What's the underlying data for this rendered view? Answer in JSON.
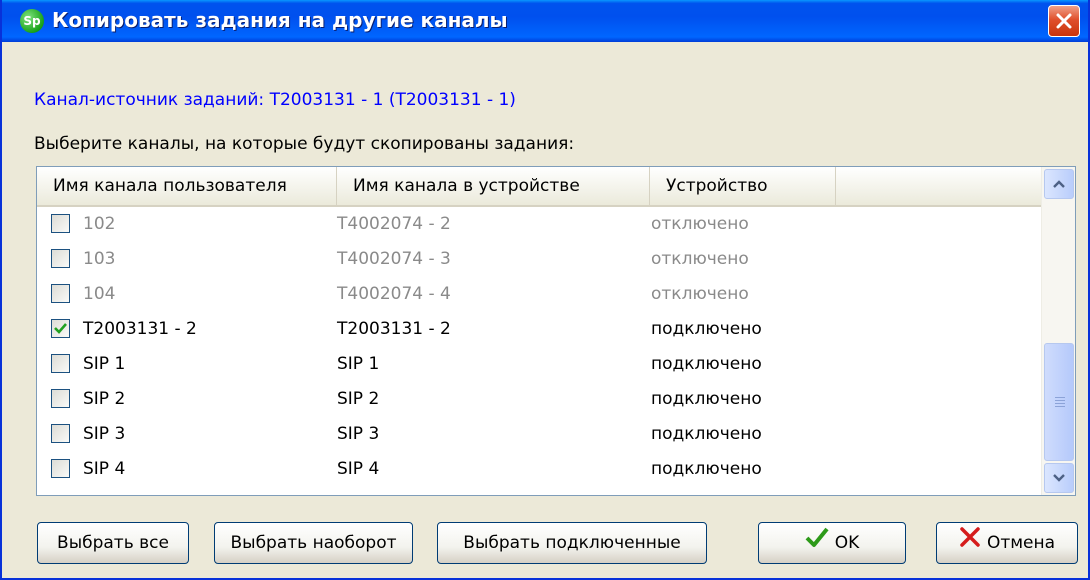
{
  "window": {
    "title": "Копировать задания на другие каналы",
    "app_icon_text": "Sp"
  },
  "source_label": "Канал-источник заданий: T2003131 - 1 (T2003131 - 1)",
  "select_label": "Выберите каналы, на которые будут скопированы задания:",
  "table": {
    "columns": [
      "Имя канала пользователя",
      "Имя канала в устройстве",
      "Устройство"
    ],
    "rows": [
      {
        "user_name": "102",
        "device_name": "T4002074 - 2",
        "status": "отключено",
        "checked": false,
        "enabled": false
      },
      {
        "user_name": "103",
        "device_name": "T4002074 - 3",
        "status": "отключено",
        "checked": false,
        "enabled": false
      },
      {
        "user_name": "104",
        "device_name": "T4002074 - 4",
        "status": "отключено",
        "checked": false,
        "enabled": false
      },
      {
        "user_name": "T2003131 - 2",
        "device_name": "T2003131 - 2",
        "status": "подключено",
        "checked": true,
        "enabled": true
      },
      {
        "user_name": "SIP 1",
        "device_name": "SIP 1",
        "status": "подключено",
        "checked": false,
        "enabled": true
      },
      {
        "user_name": "SIP 2",
        "device_name": "SIP 2",
        "status": "подключено",
        "checked": false,
        "enabled": true
      },
      {
        "user_name": "SIP 3",
        "device_name": "SIP 3",
        "status": "подключено",
        "checked": false,
        "enabled": true
      },
      {
        "user_name": "SIP 4",
        "device_name": "SIP 4",
        "status": "подключено",
        "checked": false,
        "enabled": true
      }
    ]
  },
  "buttons": {
    "select_all": "Выбрать все",
    "select_inverse": "Выбрать наоборот",
    "select_connected": "Выбрать подключенные",
    "ok": "OK",
    "cancel": "Отмена"
  },
  "icons": {
    "app": "sp-app-icon",
    "close": "close-icon",
    "check": "checkmark-icon",
    "cancel": "red-x-icon"
  },
  "colors": {
    "titlebar": "#0054e3",
    "source_text": "#0000ff",
    "checkmark": "#21a121",
    "cancel_x": "#d51c1c",
    "ok_check": "#2d9a19"
  }
}
